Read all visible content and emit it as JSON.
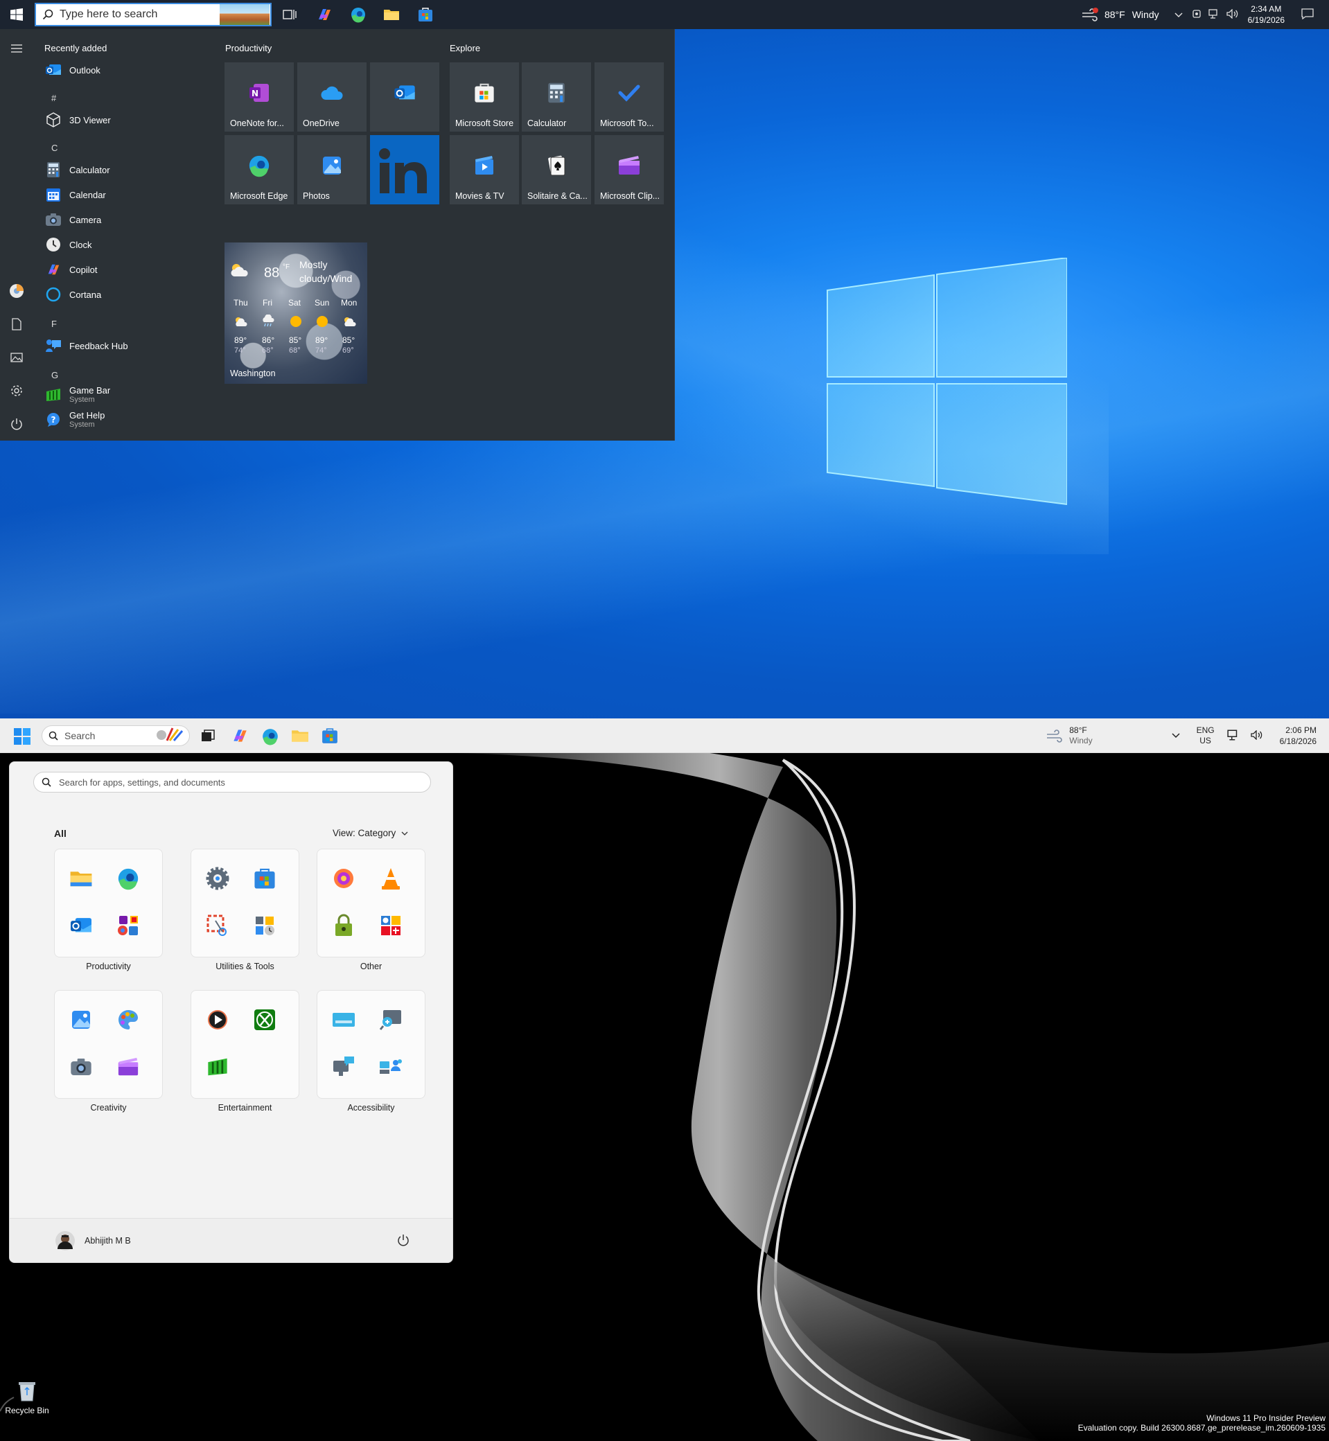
{
  "w10": {
    "taskbar": {
      "search_placeholder": "Type here to search",
      "weather_temp": "88°F",
      "weather_cond": "Windy",
      "time": "2:34 AM",
      "date": "6/19/2026"
    },
    "start_menu": {
      "recently_added": "Recently added",
      "apps": {
        "outlook": "Outlook",
        "hash": "#",
        "viewer3d": "3D Viewer",
        "letter_c": "C",
        "calculator": "Calculator",
        "calendar": "Calendar",
        "camera": "Camera",
        "clock": "Clock",
        "copilot": "Copilot",
        "cortana": "Cortana",
        "letter_f": "F",
        "feedback": "Feedback Hub",
        "letter_g": "G",
        "gamebar": "Game Bar",
        "gamebar_sub": "System",
        "gethelp": "Get Help",
        "gethelp_sub": "System"
      },
      "groups": {
        "productivity": "Productivity",
        "explore": "Explore"
      },
      "tiles": {
        "onenote": "OneNote for...",
        "onedrive": "OneDrive",
        "edge": "Microsoft Edge",
        "photos": "Photos",
        "store": "Microsoft Store",
        "calculator": "Calculator",
        "todo": "Microsoft To...",
        "movies": "Movies & TV",
        "solitaire": "Solitaire & Ca...",
        "clipchamp": "Microsoft Clip..."
      },
      "weather_tile": {
        "temp": "88",
        "unit": "°F",
        "cond_line1": "Mostly",
        "cond_line2": "cloudy/Wind",
        "days": [
          "Thu",
          "Fri",
          "Sat",
          "Sun",
          "Mon"
        ],
        "highs": [
          "89°",
          "86°",
          "85°",
          "89°",
          "85°"
        ],
        "lows": [
          "74°",
          "68°",
          "68°",
          "74°",
          "69°"
        ],
        "city": "Washington"
      }
    }
  },
  "w11": {
    "taskbar": {
      "search_placeholder": "Search",
      "weather_temp": "88°F",
      "weather_cond": "Windy",
      "lang1": "ENG",
      "lang2": "US",
      "time": "2:06 PM",
      "date": "6/18/2026"
    },
    "start_menu": {
      "search_placeholder": "Search for apps, settings, and documents",
      "all": "All",
      "view": "View: Category",
      "categories": [
        "Productivity",
        "Utilities & Tools",
        "Other",
        "Creativity",
        "Entertainment",
        "Accessibility"
      ],
      "user": "Abhijith M B"
    },
    "desktop": {
      "recycle_bin": "Recycle Bin",
      "watermark1": "Windows 11 Pro Insider Preview",
      "watermark2": "Evaluation copy. Build 26300.8687.ge_prerelease_im.260609-1935"
    }
  }
}
